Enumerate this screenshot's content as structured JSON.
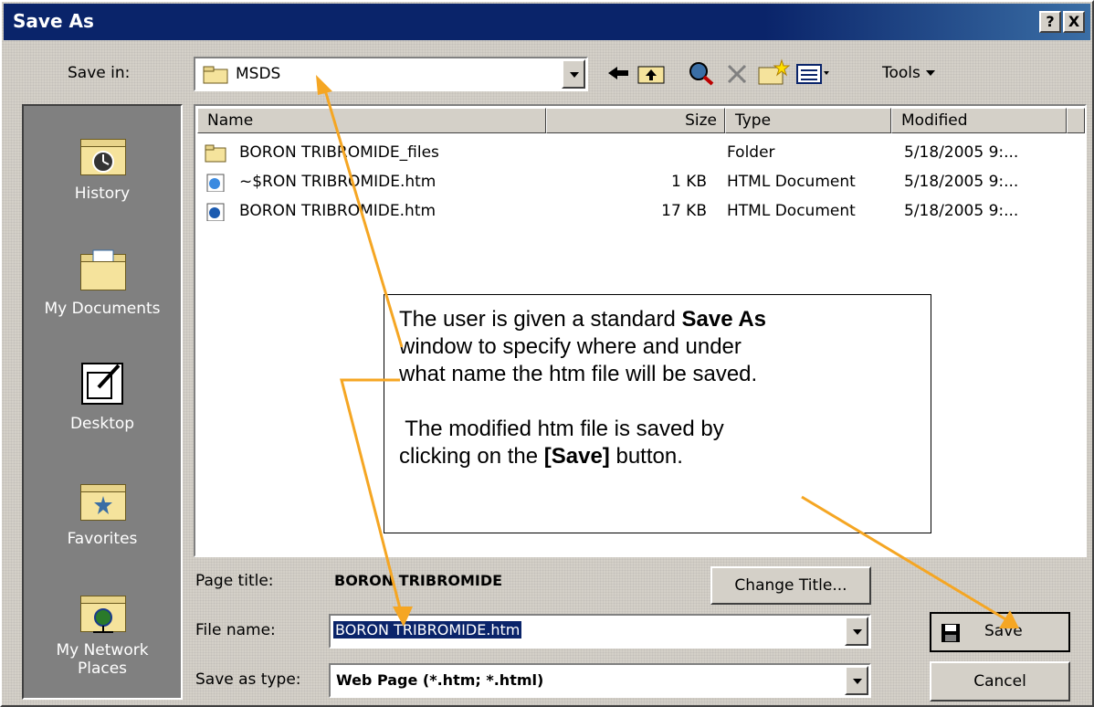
{
  "window": {
    "title": "Save As",
    "help_button": "?",
    "close_button": "X"
  },
  "save_in": {
    "label": "Save in:",
    "value": "MSDS"
  },
  "toolbar": {
    "tools_label": "Tools",
    "back_icon": "back-arrow-icon",
    "up_icon": "up-folder-icon"
  },
  "places": [
    {
      "label": "History",
      "icon": "history-icon"
    },
    {
      "label": "My Documents",
      "icon": "my-documents-icon"
    },
    {
      "label": "Desktop",
      "icon": "desktop-icon"
    },
    {
      "label": "Favorites",
      "icon": "favorites-icon"
    },
    {
      "label_line1": "My Network",
      "label_line2": "Places",
      "icon": "network-places-icon"
    }
  ],
  "columns": {
    "name": "Name",
    "size": "Size",
    "type": "Type",
    "modified": "Modified"
  },
  "files": [
    {
      "name": "BORON TRIBROMIDE_files",
      "size": "",
      "type": "Folder",
      "modified": "5/18/2005 9:...",
      "icon": "folder-icon"
    },
    {
      "name": "~$RON TRIBROMIDE.htm",
      "size": "1 KB",
      "type": "HTML Document",
      "modified": "5/18/2005 9:...",
      "icon": "html-document-icon"
    },
    {
      "name": "BORON TRIBROMIDE.htm",
      "size": "17 KB",
      "type": "HTML Document",
      "modified": "5/18/2005 9:...",
      "icon": "html-document-icon"
    }
  ],
  "page_title": {
    "label": "Page title:",
    "value": "BORON TRIBROMIDE",
    "change_button": "Change Title..."
  },
  "file_name": {
    "label": "File name:",
    "value": "BORON TRIBROMIDE.htm"
  },
  "save_as_type": {
    "label": "Save as type:",
    "value": "Web Page (*.htm; *.html)"
  },
  "buttons": {
    "save": "Save",
    "cancel": "Cancel"
  },
  "annotation": {
    "line1_pre": "The user is given a standard ",
    "line1_bold": "Save As",
    "line2": "window to specify where and under",
    "line3": "what name the htm file will be saved.",
    "line4": " The modified htm file is saved by",
    "line5_pre": "clicking on the ",
    "line5_bold": "[Save]",
    "line5_post": " button."
  },
  "colors": {
    "title_bar": "#0a246a",
    "face": "#d4d0c8",
    "selection": "#0a246a",
    "arrow": "#f5a623"
  }
}
